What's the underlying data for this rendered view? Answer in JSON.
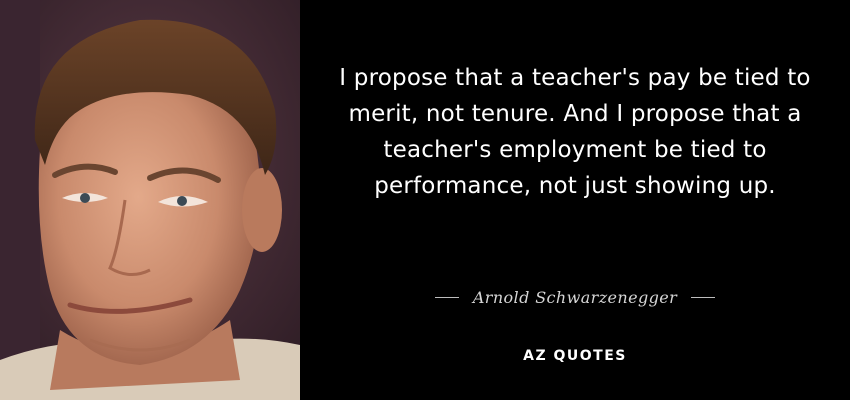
{
  "quote": {
    "text": "I propose that a teacher's pay be tied to merit, not tenure. And I propose that a teacher's employment be tied to performance, not just showing up."
  },
  "author": {
    "name": "Arnold Schwarzenegger"
  },
  "brand": {
    "logo_text": "AZ QUOTES"
  },
  "photo": {
    "subject": "portrait"
  }
}
